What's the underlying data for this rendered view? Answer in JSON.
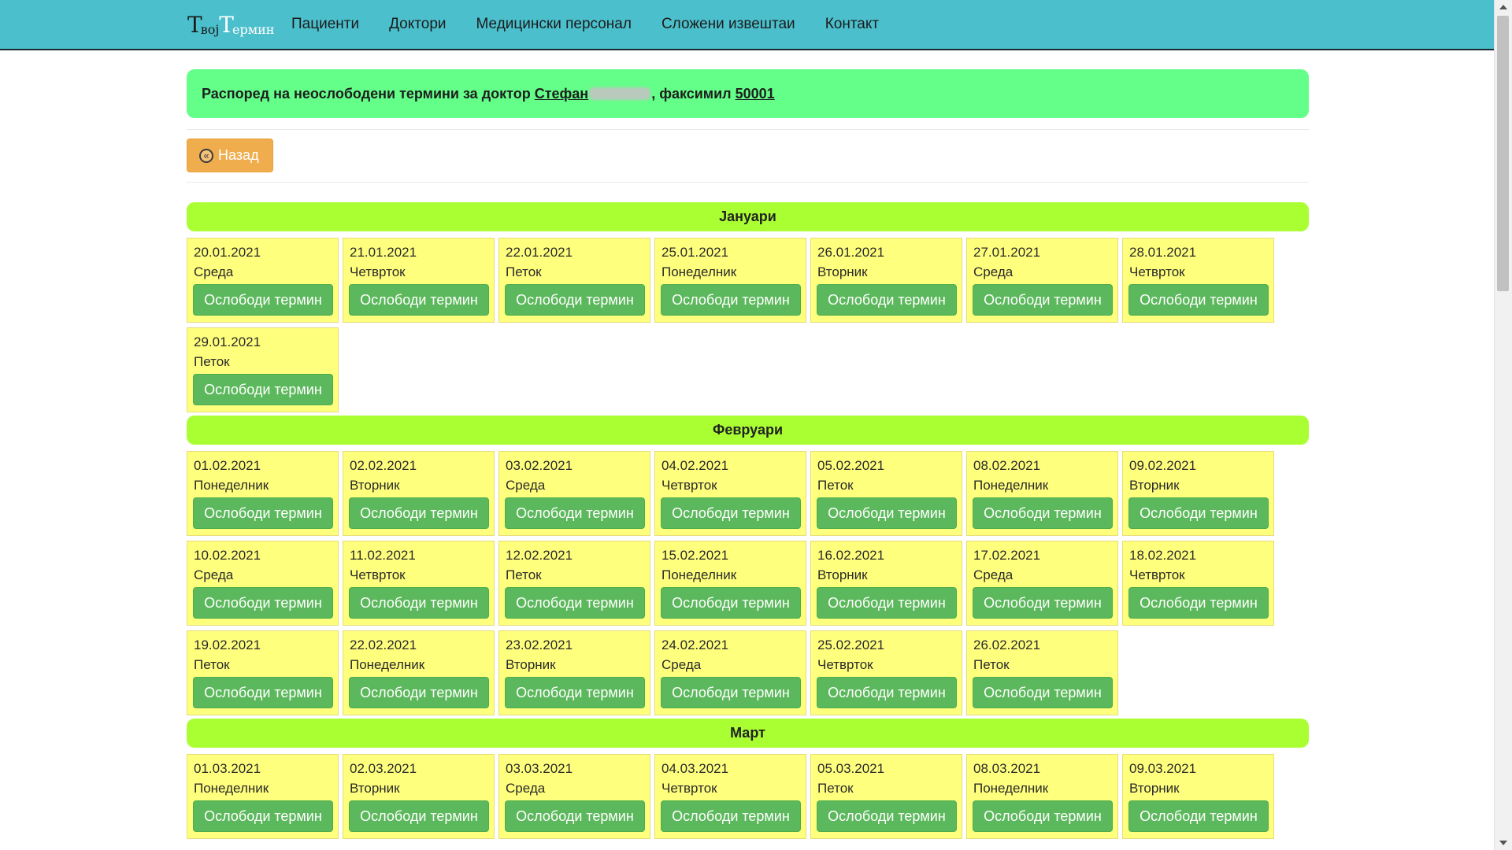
{
  "brand": {
    "part1": "Т",
    "part2": "вој",
    "part3": "Т",
    "part4": "ермин"
  },
  "nav": [
    "Пациенти",
    "Доктори",
    "Медицински персонал",
    "Сложени извештаи",
    "Контакт"
  ],
  "alert": {
    "prefix": "Распоред на неослободени термини за доктор ",
    "doctor_first_name": "Стефан",
    "middle": ", факсимил ",
    "facsimile": "50001"
  },
  "back_button": {
    "label": "Назад"
  },
  "free_button_label": "Ослободи термин",
  "months": [
    {
      "name": "Јануари",
      "days": [
        {
          "date": "20.01.2021",
          "weekday": "Среда"
        },
        {
          "date": "21.01.2021",
          "weekday": "Четврток"
        },
        {
          "date": "22.01.2021",
          "weekday": "Петок"
        },
        {
          "date": "25.01.2021",
          "weekday": "Понеделник"
        },
        {
          "date": "26.01.2021",
          "weekday": "Вторник"
        },
        {
          "date": "27.01.2021",
          "weekday": "Среда"
        },
        {
          "date": "28.01.2021",
          "weekday": "Четврток"
        },
        {
          "date": "29.01.2021",
          "weekday": "Петок"
        }
      ]
    },
    {
      "name": "Февруари",
      "days": [
        {
          "date": "01.02.2021",
          "weekday": "Понеделник"
        },
        {
          "date": "02.02.2021",
          "weekday": "Вторник"
        },
        {
          "date": "03.02.2021",
          "weekday": "Среда"
        },
        {
          "date": "04.02.2021",
          "weekday": "Четврток"
        },
        {
          "date": "05.02.2021",
          "weekday": "Петок"
        },
        {
          "date": "08.02.2021",
          "weekday": "Понеделник"
        },
        {
          "date": "09.02.2021",
          "weekday": "Вторник"
        },
        {
          "date": "10.02.2021",
          "weekday": "Среда"
        },
        {
          "date": "11.02.2021",
          "weekday": "Четврток"
        },
        {
          "date": "12.02.2021",
          "weekday": "Петок"
        },
        {
          "date": "15.02.2021",
          "weekday": "Понеделник"
        },
        {
          "date": "16.02.2021",
          "weekday": "Вторник"
        },
        {
          "date": "17.02.2021",
          "weekday": "Среда"
        },
        {
          "date": "18.02.2021",
          "weekday": "Четврток"
        },
        {
          "date": "19.02.2021",
          "weekday": "Петок"
        },
        {
          "date": "22.02.2021",
          "weekday": "Понеделник"
        },
        {
          "date": "23.02.2021",
          "weekday": "Вторник"
        },
        {
          "date": "24.02.2021",
          "weekday": "Среда"
        },
        {
          "date": "25.02.2021",
          "weekday": "Четврток"
        },
        {
          "date": "26.02.2021",
          "weekday": "Петок"
        }
      ]
    },
    {
      "name": "Март",
      "days": [
        {
          "date": "01.03.2021",
          "weekday": "Понеделник"
        },
        {
          "date": "02.03.2021",
          "weekday": "Вторник"
        },
        {
          "date": "03.03.2021",
          "weekday": "Среда"
        },
        {
          "date": "04.03.2021",
          "weekday": "Четврток"
        },
        {
          "date": "05.03.2021",
          "weekday": "Петок"
        },
        {
          "date": "08.03.2021",
          "weekday": "Понеделник"
        },
        {
          "date": "09.03.2021",
          "weekday": "Вторник"
        }
      ]
    }
  ],
  "colors": {
    "navbar": "#4bbfcc",
    "alert": "#64ff89",
    "month_header": "#aaff33",
    "cell": "#ffff7e",
    "button": "#5cb85c",
    "back_button": "#f0ad4e"
  }
}
